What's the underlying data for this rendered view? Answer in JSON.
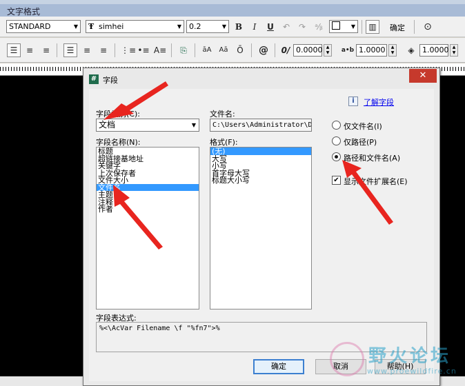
{
  "window": {
    "title": "文字格式"
  },
  "toolbar1": {
    "style_value": "STANDARD",
    "font_value": "simhei",
    "height_value": "0.2",
    "bold": "B",
    "italic": "I",
    "underline": "U",
    "ok_label": "确定"
  },
  "toolbar2": {
    "oblique_value": "0.0000",
    "tracking_value": "1.0000",
    "width_value": "1.0000"
  },
  "dialog": {
    "title": "字段",
    "learn_link": "了解字段",
    "category_label": "字段类别(C):",
    "category_value": "文档",
    "names_label": "字段名称(N):",
    "field_names": [
      "标题",
      "超链接基地址",
      "关键字",
      "上次保存者",
      "文件大小",
      "文件名",
      "主题",
      "注释",
      "作者"
    ],
    "selected_field": "文件名",
    "filename_label": "文件名:",
    "filename_value": "C:\\Users\\Administrator\\D",
    "format_label": "格式(F):",
    "formats": [
      "(无)",
      "大写",
      "小写",
      "首字母大写",
      "标题大小写"
    ],
    "selected_format": "(无)",
    "radio_filename_only": "仅文件名(I)",
    "radio_path_only": "仅路径(P)",
    "radio_path_and_name": "路径和文件名(A)",
    "checkbox_extension": "显示文件扩展名(E)",
    "expression_label": "字段表达式:",
    "expression_value": "%<\\AcVar Filename \\f \"%fn7\">%",
    "ok_label": "确定",
    "cancel_label": "取消",
    "help_label": "帮助(H)"
  },
  "watermark": {
    "text": "野火论坛",
    "url": "www.proewildfire.cn"
  }
}
